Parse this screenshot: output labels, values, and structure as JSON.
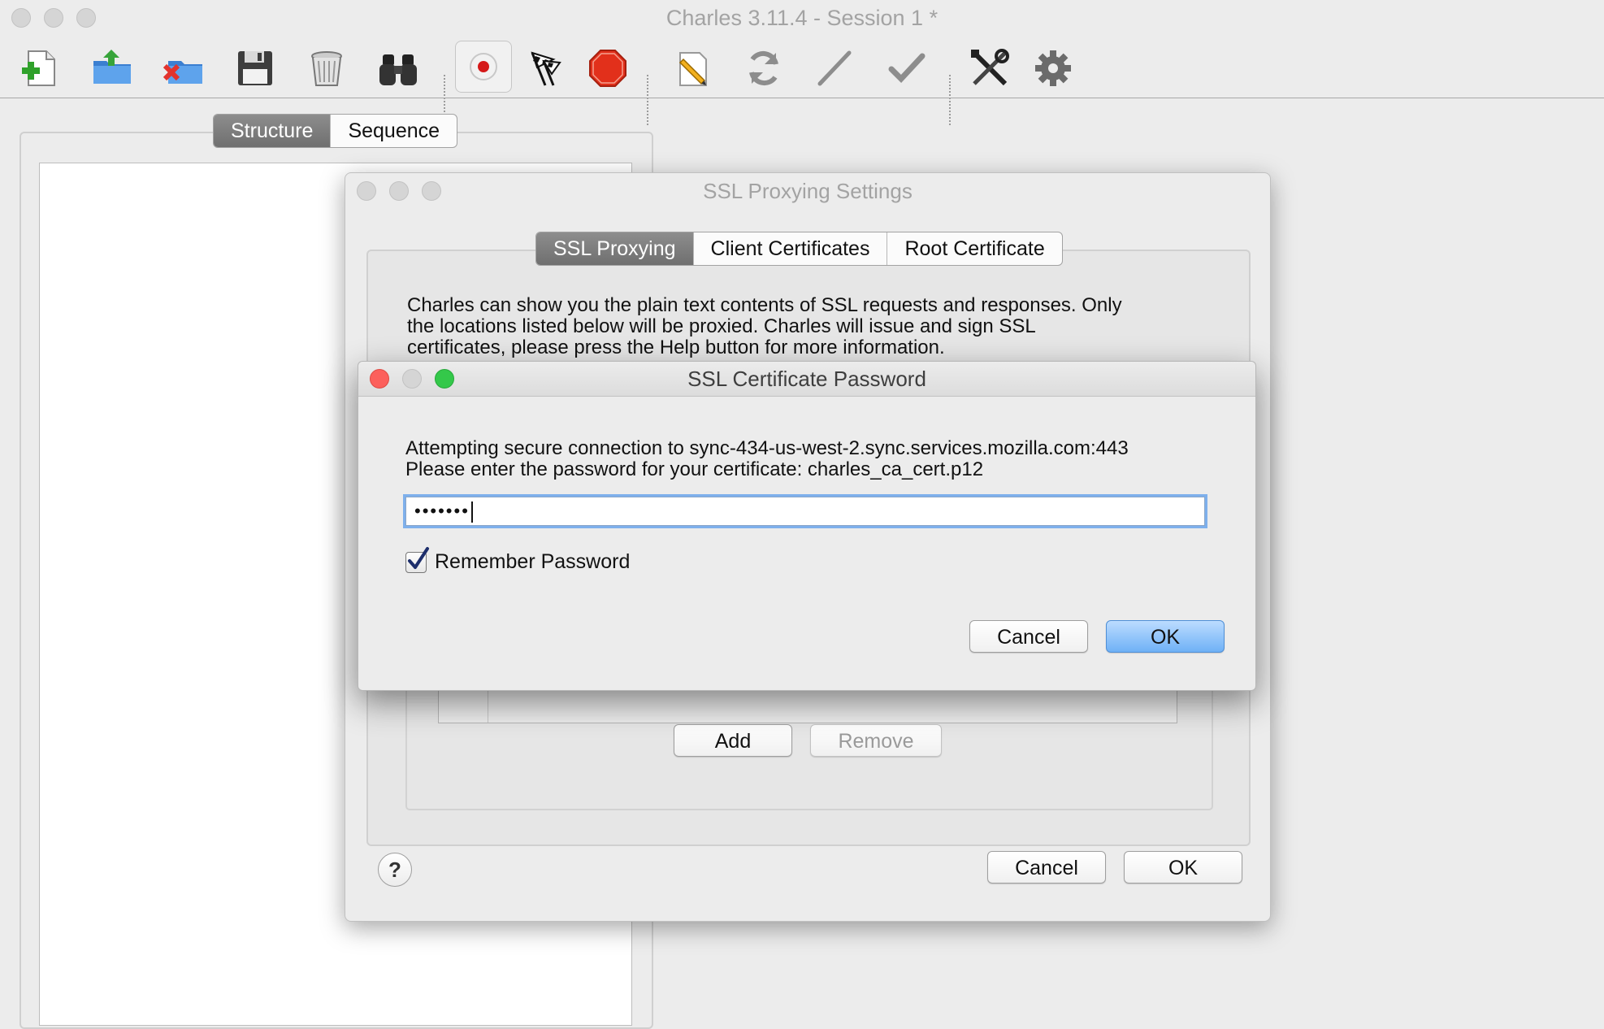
{
  "window": {
    "title": "Charles 3.11.4 - Session 1 *"
  },
  "toolbar": {
    "buttons": [
      {
        "name": "new-session-icon"
      },
      {
        "name": "open-session-icon"
      },
      {
        "name": "close-session-icon"
      },
      {
        "name": "save-session-icon"
      },
      {
        "name": "clear-session-icon"
      },
      {
        "name": "find-icon"
      },
      {
        "name": "record-icon"
      },
      {
        "name": "throttle-icon"
      },
      {
        "name": "stop-breakpoints-icon"
      },
      {
        "name": "edit-icon"
      },
      {
        "name": "repeat-icon"
      },
      {
        "name": "validate-icon"
      },
      {
        "name": "checkmark-icon"
      },
      {
        "name": "tools-icon"
      },
      {
        "name": "settings-gear-icon"
      }
    ]
  },
  "view_tabs": {
    "structure": "Structure",
    "sequence": "Sequence"
  },
  "ssl_settings": {
    "title": "SSL Proxying Settings",
    "tabs": {
      "ssl_proxying": "SSL Proxying",
      "client_certificates": "Client Certificates",
      "root_certificate": "Root Certificate"
    },
    "description_line1": "Charles can show you the plain text contents of SSL requests and responses. Only",
    "description_line2": "the locations listed below will be proxied. Charles will issue and sign SSL",
    "description_line3": "certificates, please press the Help button for more information.",
    "add_label": "Add",
    "remove_label": "Remove",
    "help_label": "?",
    "cancel_label": "Cancel",
    "ok_label": "OK"
  },
  "password_dialog": {
    "title": "SSL Certificate Password",
    "message_line1": "Attempting secure connection to sync-434-us-west-2.sync.services.mozilla.com:443",
    "message_line2": "Please enter the password for your certificate: charles_ca_cert.p12",
    "password_value": "•••••••",
    "remember_label": "Remember Password",
    "remember_checked": true,
    "cancel_label": "Cancel",
    "ok_label": "OK"
  },
  "colors": {
    "close": "#fc605c",
    "minimize": "#d4d4d4",
    "zoom": "#34c84a",
    "focus_ring": "#7eb0ec"
  }
}
